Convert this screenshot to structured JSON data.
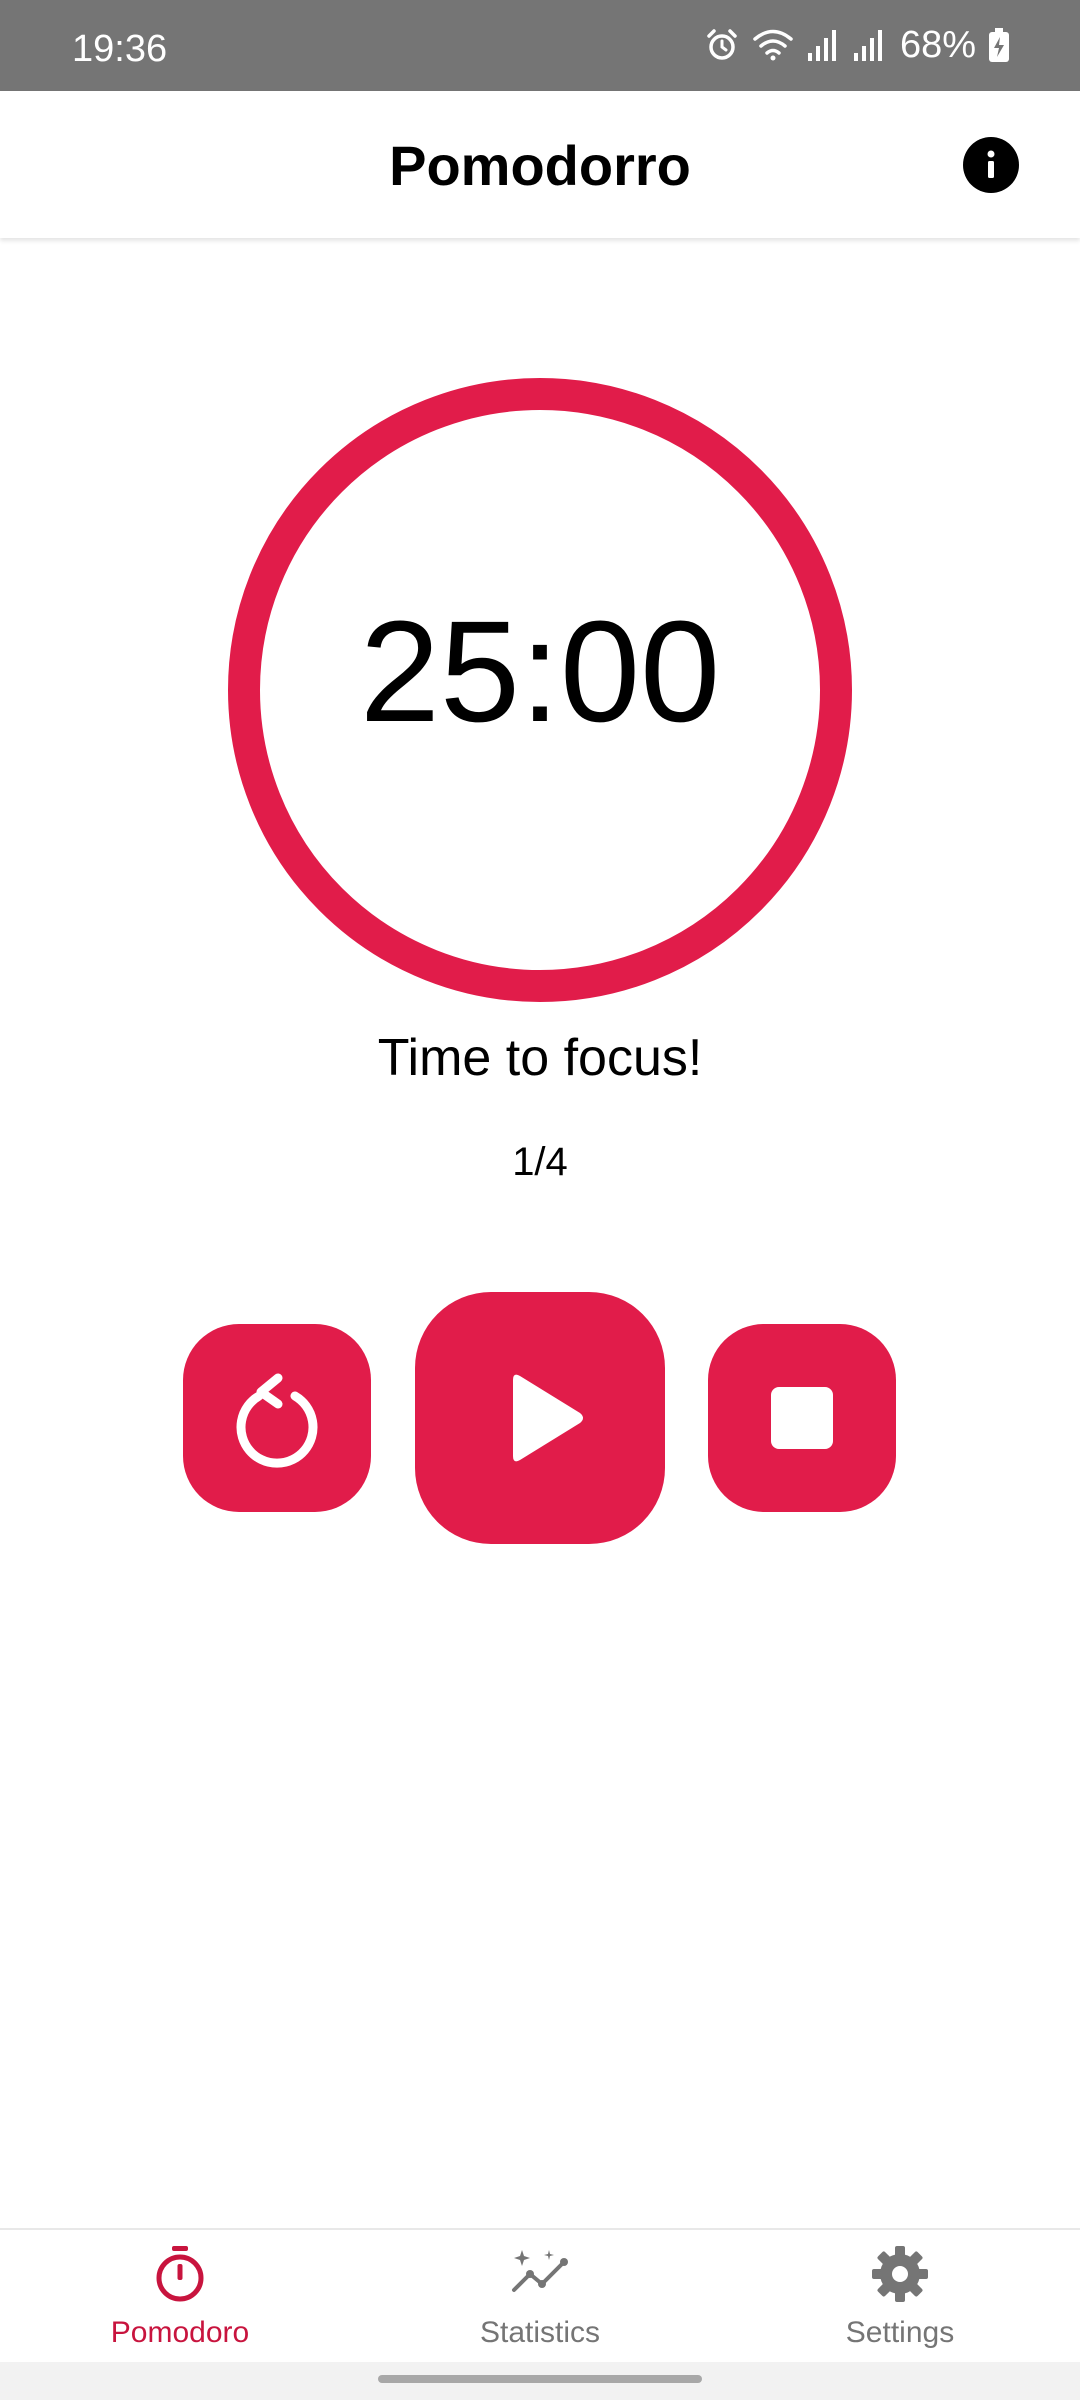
{
  "status_bar": {
    "time": "19:36",
    "battery": "68%",
    "icons": [
      "alarm-icon",
      "wifi-icon",
      "signal-icon",
      "signal-icon",
      "battery-charging-icon"
    ]
  },
  "app_bar": {
    "title": "Pomodorro",
    "info_icon": "info-icon"
  },
  "timer": {
    "time": "25:00",
    "message": "Time to focus!",
    "round": "1/4",
    "ring_color": "#e11c4a"
  },
  "controls": {
    "reset_icon": "reset-icon",
    "play_icon": "play-icon",
    "stop_icon": "stop-icon"
  },
  "bottom_nav": {
    "items": [
      {
        "label": "Pomodoro",
        "icon": "timer-icon",
        "active": true
      },
      {
        "label": "Statistics",
        "icon": "statistics-icon",
        "active": false
      },
      {
        "label": "Settings",
        "icon": "gear-icon",
        "active": false
      }
    ]
  },
  "colors": {
    "accent": "#e11c4a",
    "active_nav": "#c8143e",
    "inactive_nav": "#757575",
    "status_bar": "#757575"
  }
}
